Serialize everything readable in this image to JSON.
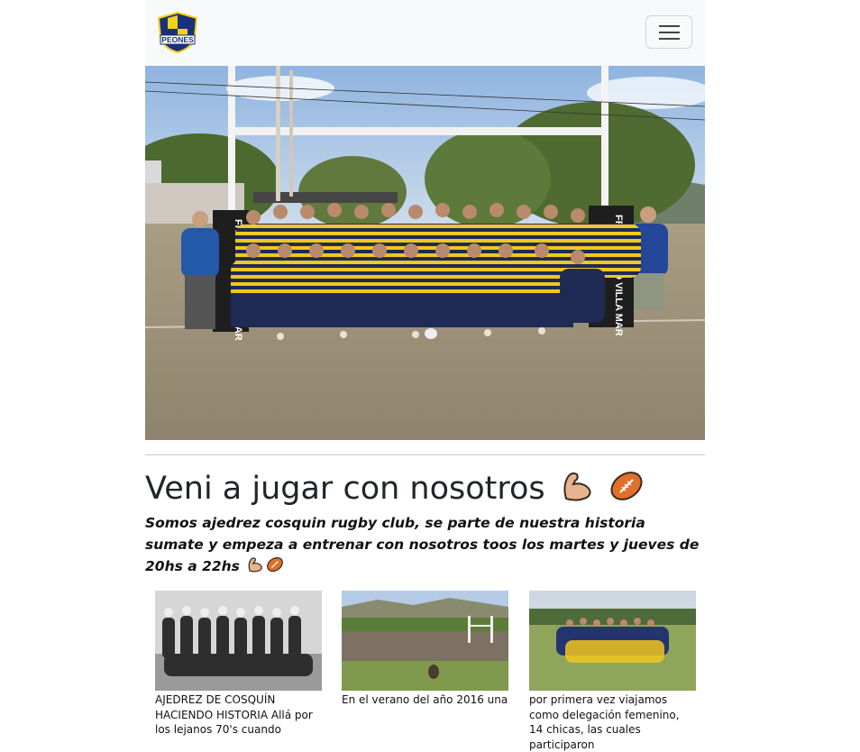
{
  "header": {
    "logo_text": "PEONES",
    "menu_icon": "hamburger-icon"
  },
  "hero": {
    "banner_left": "FRIGORIFICO VILLA MAR",
    "banner_right": "FRIGORIFICO VILLA MAR"
  },
  "main": {
    "title": "Veni a jugar con nosotros",
    "title_icons": [
      "flexed-biceps-icon",
      "rugby-football-icon"
    ],
    "lead": "Somos ajedrez cosquin rugby club, se parte de nuestra historia sumate y empeza a entrenar con nosotros toos los martes y jueves de 20hs a 22hs"
  },
  "cards": [
    {
      "caption": "AJEDREZ DE COSQUÍN HACIENDO HISTORIA Allá por los lejanos 70's cuando"
    },
    {
      "caption": "En el verano del año 2016 una"
    },
    {
      "caption": "por primera vez viajamos como delegación femenino, 14 chicas, las cuales participaron"
    }
  ],
  "colors": {
    "navbar_bg": "#f8f9fa",
    "jersey_blue": "#1f2a55",
    "jersey_yellow": "#f2c81c",
    "grass": "#b4a78a",
    "sky": "#a9c6e6"
  }
}
